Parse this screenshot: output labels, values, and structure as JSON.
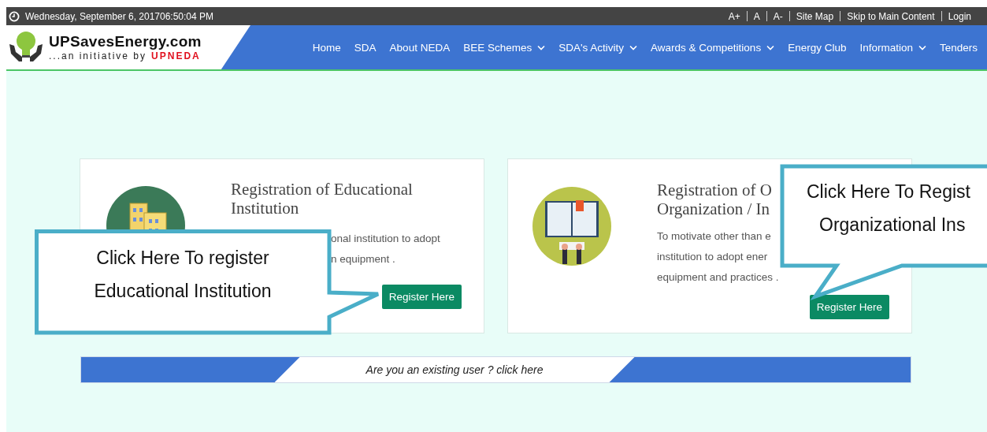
{
  "top_bar": {
    "datetime": "Wednesday, September 6, 201706:50:04 PM",
    "links": [
      "A+",
      "A",
      "A-",
      "Site Map",
      "Skip to Main Content",
      "Login"
    ]
  },
  "logo": {
    "title": "UPSavesEnergy.com",
    "tagline": "...an initiative by",
    "brand": "UPNEDA"
  },
  "nav": [
    {
      "label": "Home",
      "has_menu": false
    },
    {
      "label": "SDA",
      "has_menu": false
    },
    {
      "label": "About NEDA",
      "has_menu": false
    },
    {
      "label": "BEE Schemes",
      "has_menu": true
    },
    {
      "label": "SDA's Activity",
      "has_menu": true
    },
    {
      "label": "Awards & Competitions",
      "has_menu": true
    },
    {
      "label": "Energy Club",
      "has_menu": false
    },
    {
      "label": "Information",
      "has_menu": true
    },
    {
      "label": "Tenders",
      "has_menu": false
    }
  ],
  "cards": [
    {
      "kind": "buildings",
      "title_lines": [
        "Registration of Educational",
        "Institution"
      ],
      "description_lines": [
        "onal institution to adopt",
        "n equipment ."
      ],
      "button": "Register Here"
    },
    {
      "kind": "book",
      "title_lines": [
        "Registration of O",
        "Organization / In"
      ],
      "description_lines": [
        "To motivate other than e",
        "institution to adopt ener",
        "equipment and practices ."
      ],
      "button": "Register Here"
    }
  ],
  "existing_user_link": "Are you an existing user ? click here",
  "callouts": [
    {
      "lines": [
        "Click Here To register",
        "Educational Institution"
      ]
    },
    {
      "lines": [
        "Click Here To Regist",
        "Organizational Ins"
      ]
    }
  ]
}
